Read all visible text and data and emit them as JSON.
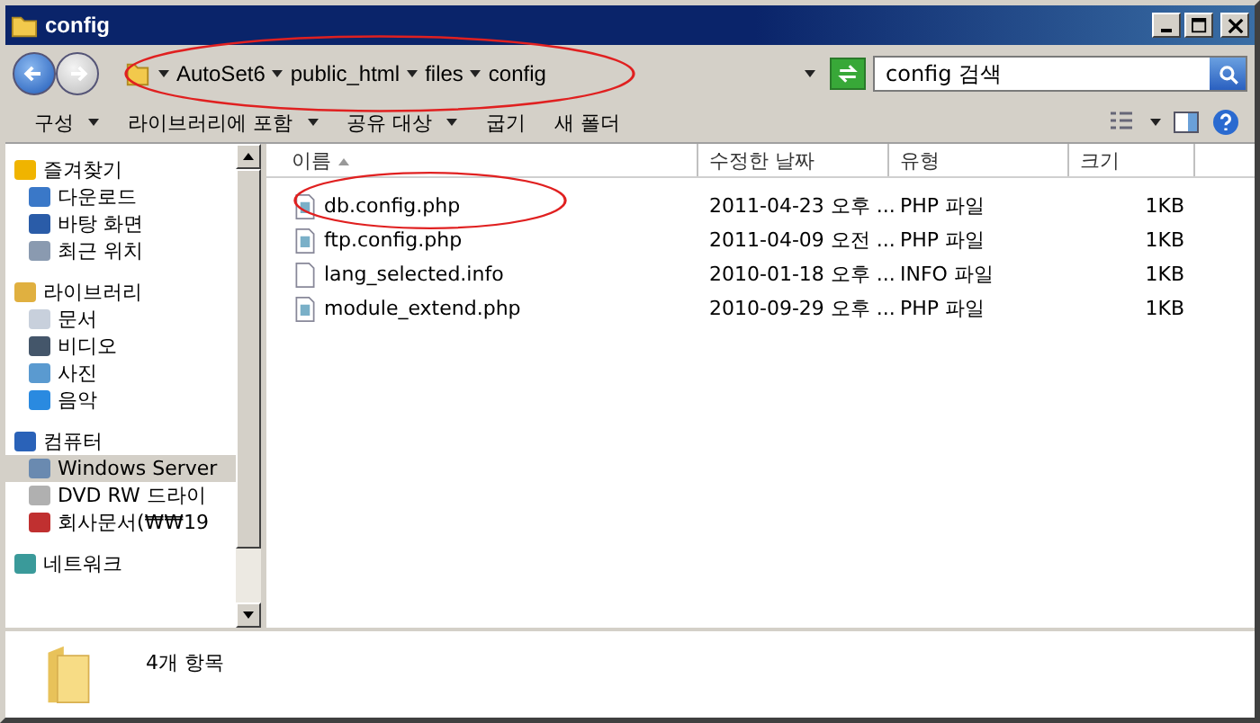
{
  "window": {
    "title": "config"
  },
  "address": {
    "breadcrumbs": [
      "AutoSet6",
      "public_html",
      "files",
      "config"
    ]
  },
  "search": {
    "placeholder": "config 검색"
  },
  "toolbar": {
    "items": [
      {
        "label": "구성",
        "has_menu": true
      },
      {
        "label": "라이브러리에 포함",
        "has_menu": true
      },
      {
        "label": "공유 대상",
        "has_menu": true
      },
      {
        "label": "굽기",
        "has_menu": false
      },
      {
        "label": "새 폴더",
        "has_menu": false
      }
    ]
  },
  "nav": {
    "sections": [
      {
        "label": "즐겨찾기",
        "kind": "star",
        "selected": false,
        "children": [
          {
            "label": "다운로드",
            "kind": "download",
            "selected": false
          },
          {
            "label": "바탕 화면",
            "kind": "desktop",
            "selected": false
          },
          {
            "label": "최근 위치",
            "kind": "recent",
            "selected": false
          }
        ]
      },
      {
        "label": "라이브러리",
        "kind": "library",
        "selected": false,
        "children": [
          {
            "label": "문서",
            "kind": "document",
            "selected": false
          },
          {
            "label": "비디오",
            "kind": "video",
            "selected": false
          },
          {
            "label": "사진",
            "kind": "picture",
            "selected": false
          },
          {
            "label": "음악",
            "kind": "music",
            "selected": false
          }
        ]
      },
      {
        "label": "컴퓨터",
        "kind": "computer",
        "selected": false,
        "children": [
          {
            "label": "Windows Server",
            "kind": "drive",
            "selected": true
          },
          {
            "label": "DVD RW 드라이",
            "kind": "disc",
            "selected": false
          },
          {
            "label": "회사문서(₩₩19",
            "kind": "netdrive",
            "selected": false
          }
        ]
      },
      {
        "label": "네트워크",
        "kind": "network",
        "selected": false
      }
    ]
  },
  "columns": [
    {
      "label": "이름",
      "sorted": true
    },
    {
      "label": "수정한 날짜",
      "sorted": false
    },
    {
      "label": "유형",
      "sorted": false
    },
    {
      "label": "크기",
      "sorted": false
    }
  ],
  "rows": [
    {
      "name": "db.config.php",
      "modified": "2011-04-23 오후 ...",
      "type": "PHP 파일",
      "size": "1KB",
      "kind": "php"
    },
    {
      "name": "ftp.config.php",
      "modified": "2011-04-09 오전 ...",
      "type": "PHP 파일",
      "size": "1KB",
      "kind": "php"
    },
    {
      "name": "lang_selected.info",
      "modified": "2010-01-18 오후 ...",
      "type": "INFO 파일",
      "size": "1KB",
      "kind": "info"
    },
    {
      "name": "module_extend.php",
      "modified": "2010-09-29 오후 ...",
      "type": "PHP 파일",
      "size": "1KB",
      "kind": "php"
    }
  ],
  "status_bar": {
    "text": "4개 항목"
  }
}
